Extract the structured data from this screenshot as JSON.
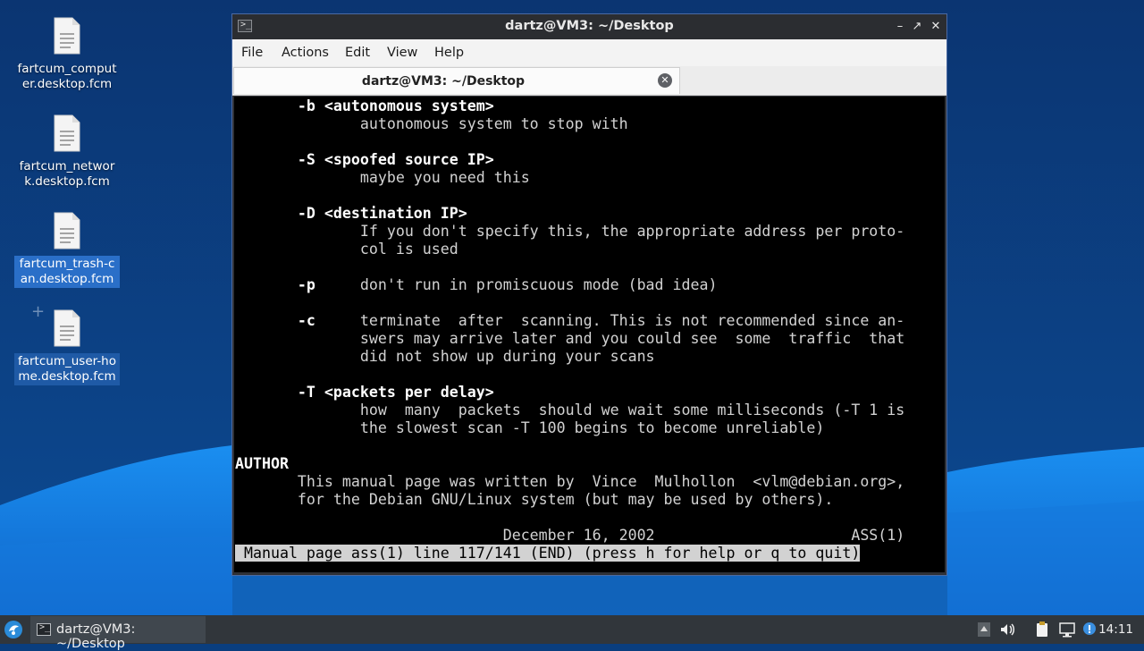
{
  "desktop": {
    "icons": [
      {
        "label": "fartcum_computer.desktop.fcm",
        "icon": "text-file-icon",
        "selected": false
      },
      {
        "label": "fartcum_network.desktop.fcm",
        "icon": "text-file-icon",
        "selected": false
      },
      {
        "label": "fartcum_trash-can.desktop.fcm",
        "icon": "text-file-icon",
        "selected": true
      },
      {
        "label": "fartcum_user-home.desktop.fcm",
        "icon": "text-file-icon",
        "selected": true
      }
    ]
  },
  "window": {
    "title": "dartz@VM3: ~/Desktop",
    "menu": [
      "File",
      "Actions",
      "Edit",
      "View",
      "Help"
    ],
    "tab_title": "dartz@VM3: ~/Desktop",
    "controls": [
      "minimize-icon",
      "maximize-icon",
      "close-icon"
    ]
  },
  "terminal": {
    "lines": [
      [
        [
          "b",
          "       -b <autonomous system>"
        ]
      ],
      [
        [
          "n",
          "              autonomous system to stop with"
        ]
      ],
      [
        [
          "n",
          ""
        ]
      ],
      [
        [
          "b",
          "       -S <spoofed source IP>"
        ]
      ],
      [
        [
          "n",
          "              maybe you need this"
        ]
      ],
      [
        [
          "n",
          ""
        ]
      ],
      [
        [
          "b",
          "       -D <destination IP>"
        ]
      ],
      [
        [
          "n",
          "              If you don't specify this, the appropriate address per proto-"
        ]
      ],
      [
        [
          "n",
          "              col is used"
        ]
      ],
      [
        [
          "n",
          ""
        ]
      ],
      [
        [
          "b",
          "       -p"
        ],
        [
          "n",
          "     don't run in promiscuous mode (bad idea)"
        ]
      ],
      [
        [
          "n",
          ""
        ]
      ],
      [
        [
          "b",
          "       -c"
        ],
        [
          "n",
          "     terminate  after  scanning. This is not recommended since an-"
        ]
      ],
      [
        [
          "n",
          "              swers may arrive later and you could see  some  traffic  that"
        ]
      ],
      [
        [
          "n",
          "              did not show up during your scans"
        ]
      ],
      [
        [
          "n",
          ""
        ]
      ],
      [
        [
          "b",
          "       -T <packets per delay>"
        ]
      ],
      [
        [
          "n",
          "              how  many  packets  should we wait some milliseconds (-T 1 is"
        ]
      ],
      [
        [
          "n",
          "              the slowest scan -T 100 begins to become unreliable)"
        ]
      ],
      [
        [
          "n",
          ""
        ]
      ],
      [
        [
          "b",
          "AUTHOR"
        ]
      ],
      [
        [
          "n",
          "       This manual page was written by  Vince  Mulhollon  <vlm@debian.org>,"
        ]
      ],
      [
        [
          "n",
          "       for the Debian GNU/Linux system (but may be used by others)."
        ]
      ],
      [
        [
          "n",
          ""
        ]
      ],
      [
        [
          "n",
          "                              December 16, 2002                      ASS(1)"
        ]
      ],
      [
        [
          "s",
          " Manual page ass(1) line 117/141 (END) (press h for help or q to quit)"
        ],
        [
          "n",
          " "
        ]
      ]
    ]
  },
  "taskbar": {
    "start_icon": "lxqt-start-icon",
    "task_label": "dartz@VM3: ~/Desktop",
    "tray": [
      "arrow-up-icon",
      "volume-icon",
      "clipboard-icon",
      "network-icon",
      "update-notifier-icon"
    ],
    "clock": "14:11"
  },
  "colors": {
    "desktop_bg": "#0a3e7e",
    "terminal_bg": "#000000",
    "terminal_fg": "#d2d2d2",
    "taskbar_bg": "#31363b",
    "selection": "#2a6fc8"
  }
}
